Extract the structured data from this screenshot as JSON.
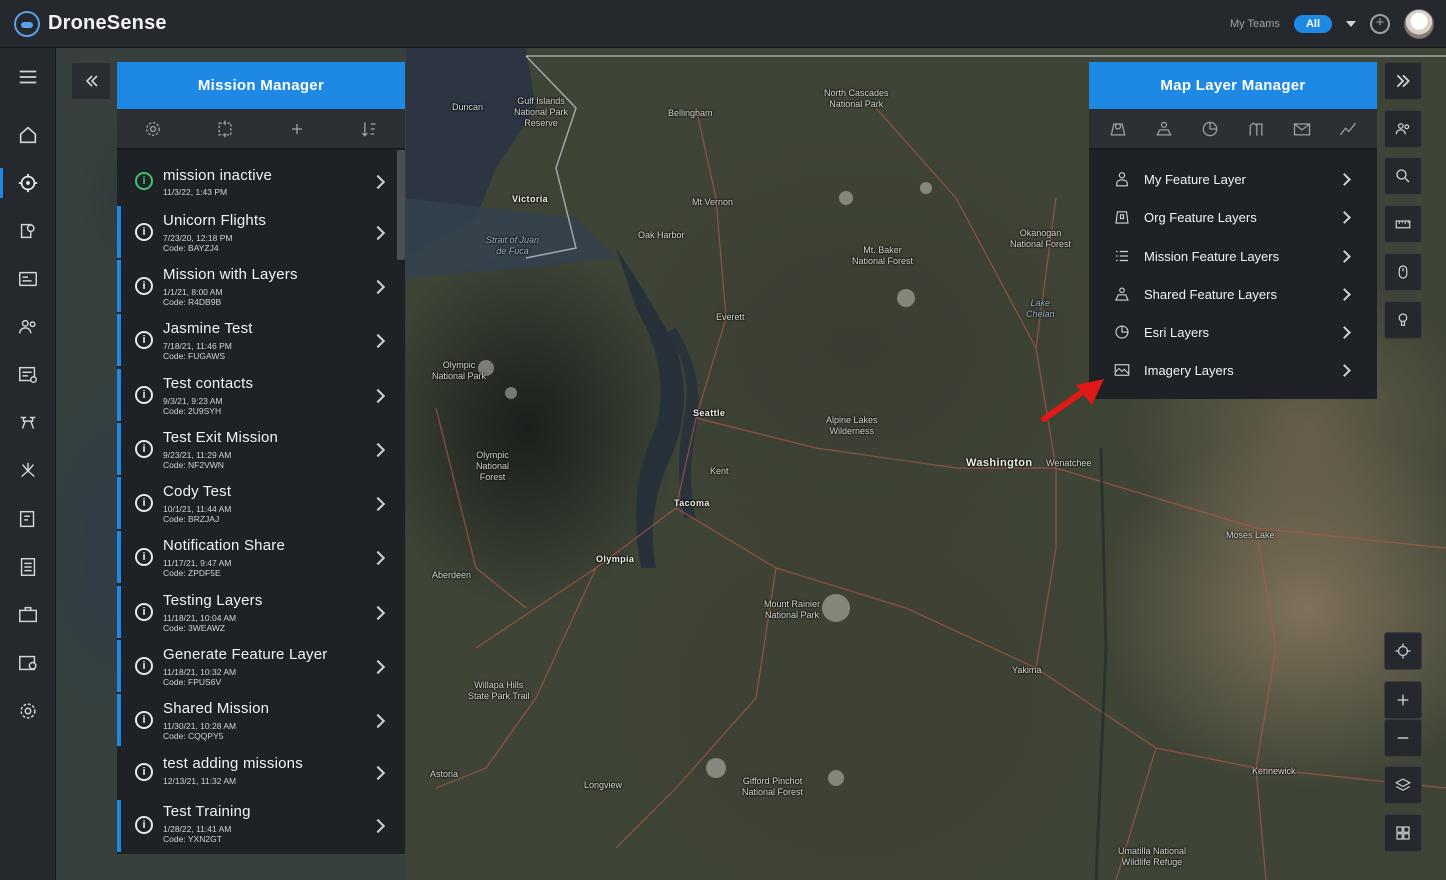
{
  "app": {
    "name": "DroneSense"
  },
  "header": {
    "my_teams_label": "My Teams",
    "team_filter": "All"
  },
  "mission_manager": {
    "title": "Mission Manager",
    "missions": [
      {
        "name": "mission inactive",
        "date": "11/3/22, 1:43 PM",
        "code": "",
        "status": "active",
        "shared": false
      },
      {
        "name": "Unicorn Flights",
        "date": "7/23/20, 12:18 PM",
        "code": "Code: BAYZJ4",
        "status": "inactive",
        "shared": true
      },
      {
        "name": "Mission with Layers",
        "date": "1/1/21, 8:00 AM",
        "code": "Code: R4DB9B",
        "status": "inactive",
        "shared": true
      },
      {
        "name": "Jasmine Test",
        "date": "7/18/21, 11:46 PM",
        "code": "Code: FUGAWS",
        "status": "inactive",
        "shared": true
      },
      {
        "name": "Test contacts",
        "date": "9/3/21, 9:23 AM",
        "code": "Code: 2U9SYH",
        "status": "inactive",
        "shared": true
      },
      {
        "name": "Test Exit Mission",
        "date": "9/23/21, 11:29 AM",
        "code": "Code: NF2VWN",
        "status": "inactive",
        "shared": true
      },
      {
        "name": "Cody Test",
        "date": "10/1/21, 11:44 AM",
        "code": "Code: BRZJAJ",
        "status": "inactive",
        "shared": true
      },
      {
        "name": "Notification Share",
        "date": "11/17/21, 9:47 AM",
        "code": "Code: ZPDF5E",
        "status": "inactive",
        "shared": true
      },
      {
        "name": "Testing Layers",
        "date": "11/18/21, 10:04 AM",
        "code": "Code: 3WEAWZ",
        "status": "inactive",
        "shared": true
      },
      {
        "name": "Generate Feature Layer",
        "date": "11/18/21, 10:32 AM",
        "code": "Code: FPUS6V",
        "status": "inactive",
        "shared": true
      },
      {
        "name": "Shared Mission",
        "date": "11/30/21, 10:28 AM",
        "code": "Code: CQQPY5",
        "status": "inactive",
        "shared": true
      },
      {
        "name": "test adding missions",
        "date": "12/13/21, 11:32 AM",
        "code": "",
        "status": "inactive",
        "shared": false
      },
      {
        "name": "Test Training",
        "date": "1/28/22, 11:41 AM",
        "code": "Code: YXN2GT",
        "status": "inactive",
        "shared": true
      }
    ]
  },
  "layer_manager": {
    "title": "Map Layer Manager",
    "items": [
      {
        "label": "My Feature Layer",
        "icon": "person-icon"
      },
      {
        "label": "Org Feature Layers",
        "icon": "org-map-icon"
      },
      {
        "label": "Mission Feature Layers",
        "icon": "list-icon"
      },
      {
        "label": "Shared Feature Layers",
        "icon": "shared-layers-icon"
      },
      {
        "label": "Esri Layers",
        "icon": "globe-icon"
      },
      {
        "label": "Imagery Layers",
        "icon": "imagery-icon"
      }
    ]
  },
  "map": {
    "labels": [
      {
        "text": "Duncan",
        "type": "place"
      },
      {
        "text": "Gulf Islands\nNational Park\nReserve",
        "type": "place"
      },
      {
        "text": "Bellingham",
        "type": "place"
      },
      {
        "text": "North Cascades\nNational Park",
        "type": "place"
      },
      {
        "text": "Victoria",
        "type": "place"
      },
      {
        "text": "Mt Vernon",
        "type": "place"
      },
      {
        "text": "Strait of Juan\nde Fuca",
        "type": "water"
      },
      {
        "text": "Oak Harbor",
        "type": "place"
      },
      {
        "text": "Mt. Baker\nNational Forest",
        "type": "place"
      },
      {
        "text": "Okanogan\nNational Forest",
        "type": "place"
      },
      {
        "text": "Lake\nChelan",
        "type": "water"
      },
      {
        "text": "Everett",
        "type": "place"
      },
      {
        "text": "Olympic\nNational Park",
        "type": "place"
      },
      {
        "text": "Seattle",
        "type": "place"
      },
      {
        "text": "Alpine Lakes\nWilderness",
        "type": "place"
      },
      {
        "text": "Olympic\nNational\nForest",
        "type": "place"
      },
      {
        "text": "Kent",
        "type": "place"
      },
      {
        "text": "Washington",
        "type": "state"
      },
      {
        "text": "Wenatchee",
        "type": "place"
      },
      {
        "text": "Tacoma",
        "type": "place"
      },
      {
        "text": "Moses Lake",
        "type": "place"
      },
      {
        "text": "Olympia",
        "type": "place"
      },
      {
        "text": "Aberdeen",
        "type": "place"
      },
      {
        "text": "Mount Rainier\nNational Park",
        "type": "place"
      },
      {
        "text": "Yakima",
        "type": "place"
      },
      {
        "text": "Willapa Hills\nState Park Trail",
        "type": "place"
      },
      {
        "text": "Astoria",
        "type": "place"
      },
      {
        "text": "Longview",
        "type": "place"
      },
      {
        "text": "Gifford Pinchot\nNational Forest",
        "type": "place"
      },
      {
        "text": "Kennewick",
        "type": "place"
      },
      {
        "text": "Umatilla National\nWildlife Refuge",
        "type": "place"
      }
    ]
  }
}
